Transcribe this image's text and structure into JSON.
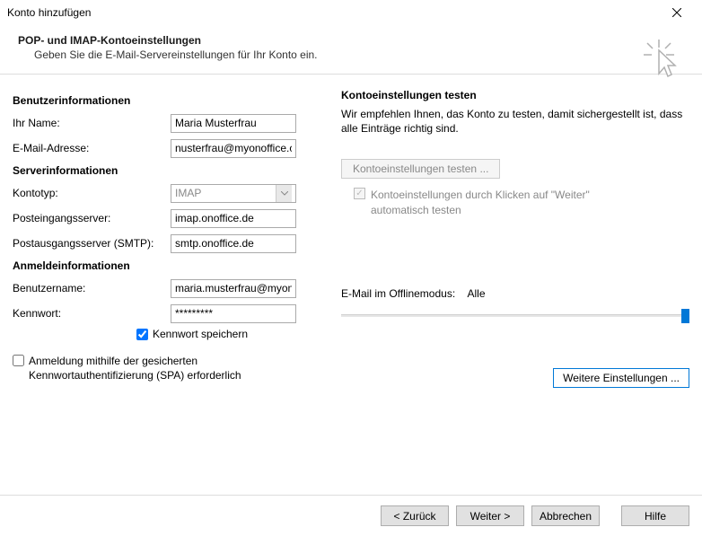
{
  "window": {
    "title": "Konto hinzufügen"
  },
  "header": {
    "title": "POP- und IMAP-Kontoeinstellungen",
    "subtitle": "Geben Sie die E-Mail-Servereinstellungen für Ihr Konto ein."
  },
  "user_info": {
    "section": "Benutzerinformationen",
    "name_label": "Ihr Name:",
    "name_value": "Maria Musterfrau",
    "email_label": "E-Mail-Adresse:",
    "email_value": "nusterfrau@myonoffice.com"
  },
  "server_info": {
    "section": "Serverinformationen",
    "type_label": "Kontotyp:",
    "type_value": "IMAP",
    "incoming_label": "Posteingangsserver:",
    "incoming_value": "imap.onoffice.de",
    "outgoing_label": "Postausgangsserver (SMTP):",
    "outgoing_value": "smtp.onoffice.de"
  },
  "login_info": {
    "section": "Anmeldeinformationen",
    "user_label": "Benutzername:",
    "user_value": "maria.musterfrau@myonoffi",
    "pass_label": "Kennwort:",
    "pass_value": "*********",
    "save_pass_label": "Kennwort speichern",
    "spa_label": "Anmeldung mithilfe der gesicherten Kennwortauthentifizierung (SPA) erforderlich"
  },
  "test": {
    "section": "Kontoeinstellungen testen",
    "text": "Wir empfehlen Ihnen, das Konto zu testen, damit sichergestellt ist, dass alle Einträge richtig sind.",
    "button": "Kontoeinstellungen testen ...",
    "auto_label": "Kontoeinstellungen durch Klicken auf \"Weiter\" automatisch testen"
  },
  "offline": {
    "label": "E-Mail im Offlinemodus:",
    "value": "Alle"
  },
  "more_settings": "Weitere Einstellungen ...",
  "footer": {
    "back": "< Zurück",
    "next": "Weiter >",
    "cancel": "Abbrechen",
    "help": "Hilfe"
  }
}
